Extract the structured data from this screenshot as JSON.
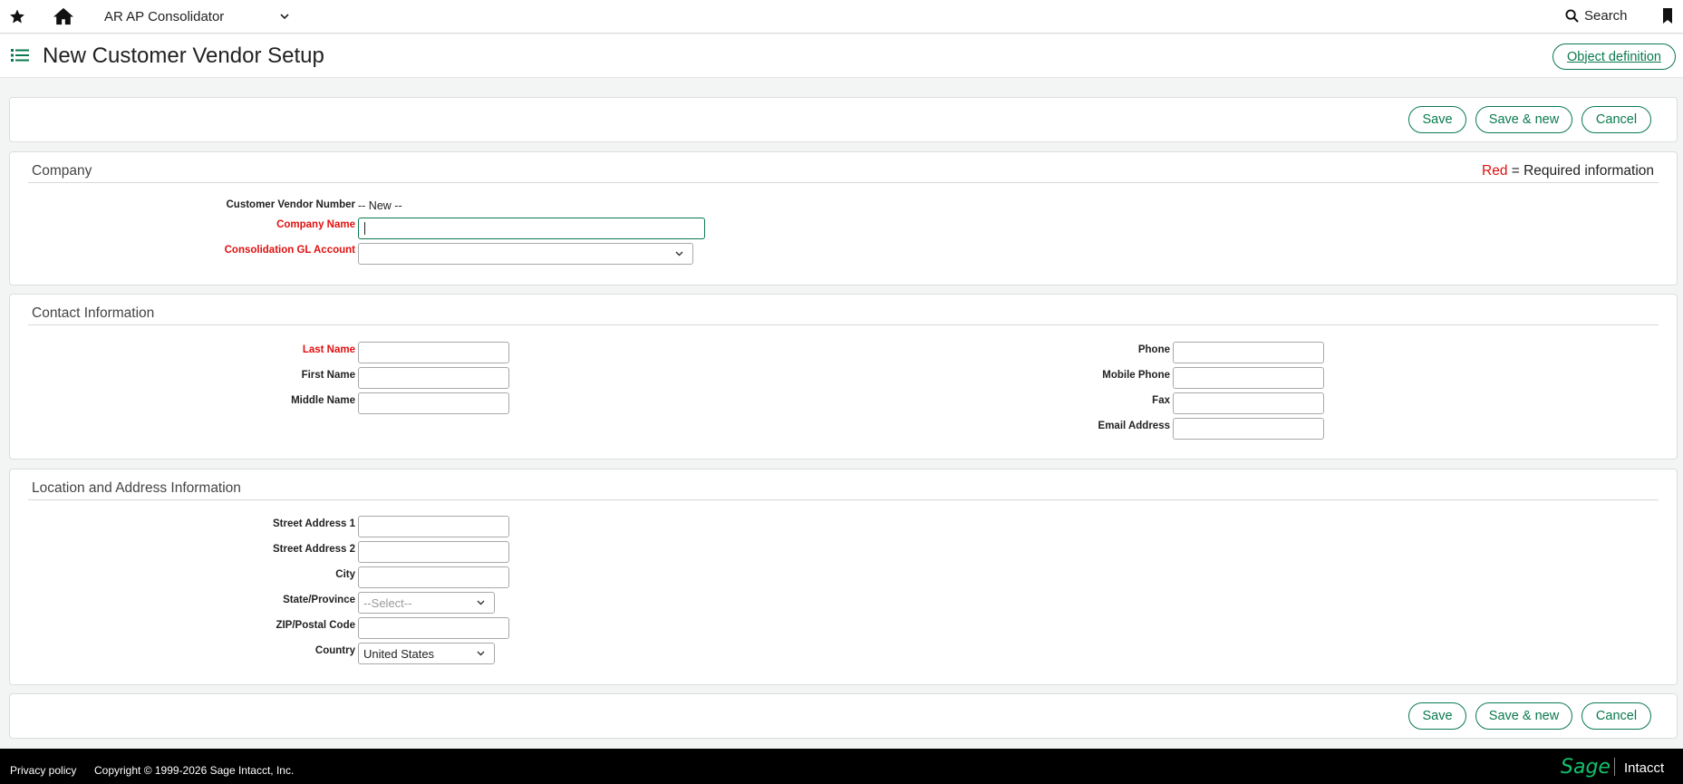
{
  "topbar": {
    "app_name": "AR AP Consolidator",
    "search_label": "Search"
  },
  "header": {
    "title": "New Customer Vendor Setup",
    "object_definition": "Object definition"
  },
  "actions": {
    "save": "Save",
    "save_new": "Save & new",
    "cancel": "Cancel"
  },
  "company": {
    "title": "Company",
    "required_red": "Red",
    "required_rest": " = Required information",
    "customer_vendor_number_label": "Customer Vendor Number",
    "customer_vendor_number_value": "-- New --",
    "company_name_label": "Company Name",
    "consolidation_gl_label": "Consolidation GL Account"
  },
  "contact": {
    "title": "Contact Information",
    "last_name": "Last Name",
    "first_name": "First Name",
    "middle_name": "Middle Name",
    "phone": "Phone",
    "mobile_phone": "Mobile Phone",
    "fax": "Fax",
    "email": "Email Address"
  },
  "location": {
    "title": "Location and Address Information",
    "street1": "Street Address 1",
    "street2": "Street Address 2",
    "city": "City",
    "state": "State/Province",
    "state_value": "--Select--",
    "zip": "ZIP/Postal Code",
    "country": "Country",
    "country_value": "United States"
  },
  "footer": {
    "privacy": "Privacy policy",
    "copyright": "Copyright © 1999-2026 Sage Intacct, Inc.",
    "brand_sage": "Sage",
    "brand_intacct": "Intacct"
  },
  "colors": {
    "accent": "#0a7a4e",
    "required": "#e01010",
    "footer_bg": "#000000",
    "brand_green": "#14c06a"
  }
}
